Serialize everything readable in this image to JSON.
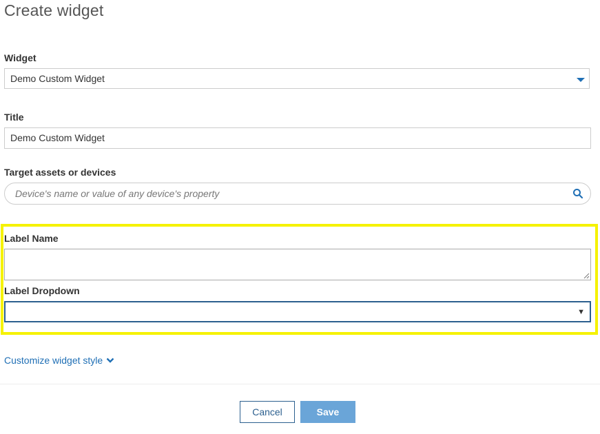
{
  "page": {
    "title": "Create widget"
  },
  "widget": {
    "label": "Widget",
    "selected": "Demo Custom Widget"
  },
  "title_field": {
    "label": "Title",
    "value": "Demo Custom Widget"
  },
  "target": {
    "label": "Target assets or devices",
    "placeholder": "Device's name or value of any device's property",
    "icon": "search-icon"
  },
  "custom_fields": {
    "label_name": {
      "label": "Label Name",
      "value": ""
    },
    "label_dropdown": {
      "label": "Label Dropdown",
      "selected": "",
      "arrow": "▼"
    },
    "highlight_color": "#f5f200"
  },
  "customize": {
    "link_text": "Customize widget style",
    "icon": "chevron-down-icon"
  },
  "actions": {
    "cancel_label": "Cancel",
    "save_label": "Save"
  },
  "colors": {
    "accent": "#1f6fb5",
    "save_bg": "#6aa5d8",
    "border_dark": "#2b5f8e"
  }
}
